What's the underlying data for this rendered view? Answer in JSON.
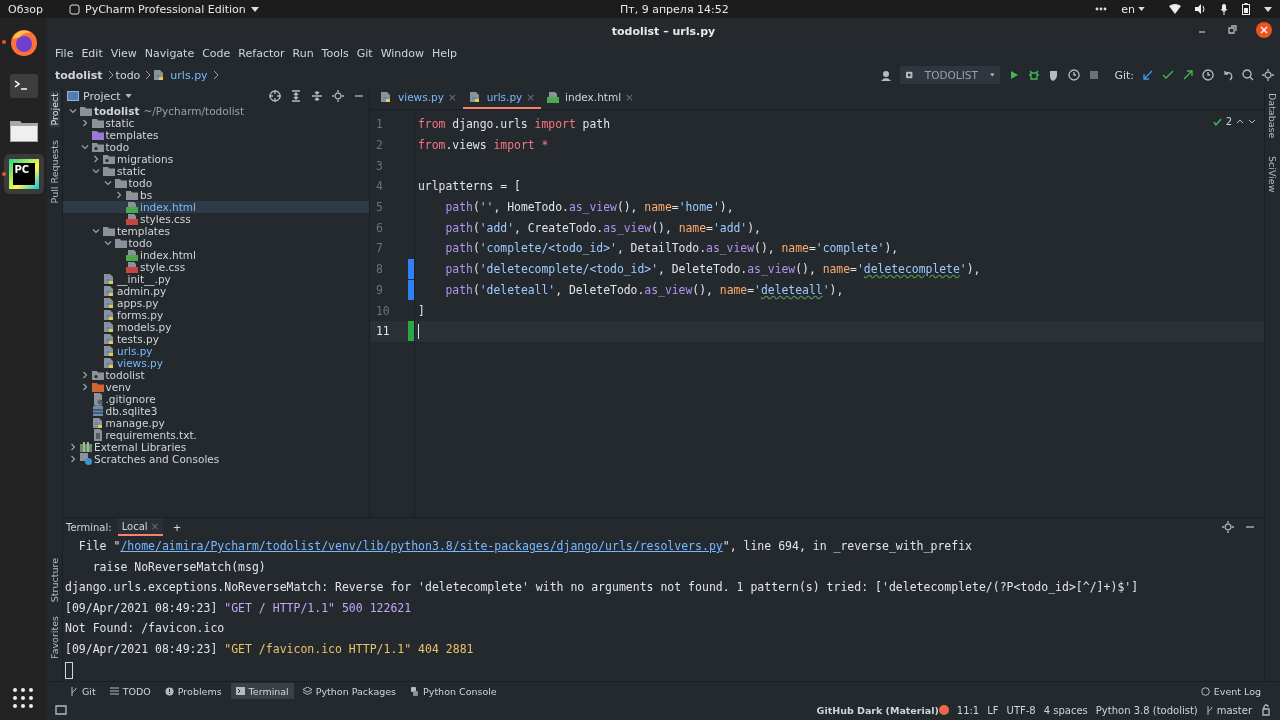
{
  "top_bar": {
    "activities": "Обзор",
    "app_menu": "PyCharm Professional Edition",
    "clock": "Пт, 9 апреля  14:52",
    "keyboard_layout": "en"
  },
  "dock": [
    {
      "kind": "firefox",
      "running": true,
      "selected": false
    },
    {
      "kind": "terminal",
      "running": false,
      "selected": false
    },
    {
      "kind": "files",
      "running": false,
      "selected": false
    },
    {
      "kind": "pycharm",
      "label": "PC",
      "running": true,
      "selected": true
    }
  ],
  "window": {
    "title": "todolist – urls.py"
  },
  "menu": [
    "File",
    "Edit",
    "View",
    "Navigate",
    "Code",
    "Refactor",
    "Run",
    "Tools",
    "Git",
    "Window",
    "Help"
  ],
  "breadcrumbs": [
    "todolist",
    "todo",
    "urls.py"
  ],
  "toolbar": {
    "run_config": "TODOLIST",
    "git_label": "Git:"
  },
  "left_stripe": {
    "top": [
      {
        "label": "Project",
        "selected": true
      },
      {
        "label": "Pull Requests",
        "selected": false
      }
    ],
    "bottom": [
      {
        "label": "Structure",
        "selected": false
      },
      {
        "label": "Favorites",
        "selected": false
      }
    ]
  },
  "project": {
    "title": "Project",
    "tree": [
      {
        "name": "todolist",
        "path": "~/Pycharm/todolist",
        "kind": "folder",
        "expanded": true,
        "selected": false,
        "modified": false,
        "children": [
          {
            "name": "static",
            "kind": "folder",
            "expanded": false,
            "selected": false,
            "modified": false
          },
          {
            "name": "templates",
            "kind": "template_folder",
            "selected": false,
            "modified": false
          },
          {
            "name": "todo",
            "kind": "package",
            "expanded": true,
            "selected": false,
            "modified": false,
            "children": [
              {
                "name": "migrations",
                "kind": "package",
                "expanded": false,
                "selected": false,
                "modified": false
              },
              {
                "name": "static",
                "kind": "folder",
                "expanded": true,
                "selected": false,
                "modified": false,
                "children": [
                  {
                    "name": "todo",
                    "kind": "folder",
                    "expanded": true,
                    "selected": false,
                    "modified": false,
                    "children": [
                      {
                        "name": "bs",
                        "kind": "folder",
                        "expanded": false,
                        "selected": false,
                        "modified": false
                      },
                      {
                        "name": "index.html",
                        "kind": "html",
                        "selected": true,
                        "modified": true
                      },
                      {
                        "name": "styles.css",
                        "kind": "css",
                        "selected": false,
                        "modified": false
                      }
                    ]
                  }
                ]
              },
              {
                "name": "templates",
                "kind": "folder",
                "expanded": true,
                "selected": false,
                "modified": false,
                "children": [
                  {
                    "name": "todo",
                    "kind": "folder",
                    "expanded": true,
                    "selected": false,
                    "modified": false,
                    "children": [
                      {
                        "name": "index.html",
                        "kind": "html",
                        "selected": false,
                        "modified": false
                      },
                      {
                        "name": "style.css",
                        "kind": "css",
                        "selected": false,
                        "modified": false
                      }
                    ]
                  }
                ]
              },
              {
                "name": "__init__.py",
                "kind": "py",
                "selected": false,
                "modified": false
              },
              {
                "name": "admin.py",
                "kind": "py",
                "selected": false,
                "modified": false
              },
              {
                "name": "apps.py",
                "kind": "py",
                "selected": false,
                "modified": false
              },
              {
                "name": "forms.py",
                "kind": "py",
                "selected": false,
                "modified": false
              },
              {
                "name": "models.py",
                "kind": "py",
                "selected": false,
                "modified": false
              },
              {
                "name": "tests.py",
                "kind": "py",
                "selected": false,
                "modified": false
              },
              {
                "name": "urls.py",
                "kind": "py",
                "selected": false,
                "modified": true
              },
              {
                "name": "views.py",
                "kind": "py",
                "selected": false,
                "modified": true
              }
            ]
          },
          {
            "name": "todolist",
            "kind": "package",
            "expanded": false,
            "selected": false,
            "modified": false
          },
          {
            "name": "venv",
            "kind": "excluded_folder",
            "expanded": false,
            "selected": false,
            "modified": false
          },
          {
            "name": ".gitignore",
            "kind": "gitignore",
            "selected": false,
            "modified": false
          },
          {
            "name": "db.sqlite3",
            "kind": "db",
            "selected": false,
            "modified": false
          },
          {
            "name": "manage.py",
            "kind": "py",
            "selected": false,
            "modified": false
          },
          {
            "name": "requirements.txt.",
            "kind": "txt",
            "selected": false,
            "modified": false
          }
        ]
      },
      {
        "name": "External Libraries",
        "kind": "libraries",
        "expanded": false,
        "selected": false,
        "modified": false
      },
      {
        "name": "Scratches and Consoles",
        "kind": "scratches",
        "expanded": false,
        "selected": false,
        "modified": false
      }
    ]
  },
  "editor": {
    "tabs": [
      {
        "label": "views.py",
        "kind": "py",
        "selected": false,
        "modified": true,
        "close": "×"
      },
      {
        "label": "urls.py",
        "kind": "py",
        "selected": true,
        "modified": true,
        "close": "×"
      },
      {
        "label": "index.html",
        "kind": "html",
        "selected": false,
        "modified": false,
        "close": "×"
      }
    ],
    "inspections": "2",
    "lines": [
      {
        "number": "1",
        "current": false,
        "modified": false,
        "added": false,
        "tokens": [
          {
            "text": "from",
            "kind": "kw"
          },
          {
            "text": " django.urls ",
            "kind": "plain"
          },
          {
            "text": "import",
            "kind": "kw"
          },
          {
            "text": " path",
            "kind": "plain"
          }
        ]
      },
      {
        "number": "2",
        "current": false,
        "modified": false,
        "added": false,
        "tokens": [
          {
            "text": "from",
            "kind": "kw"
          },
          {
            "text": ".views ",
            "kind": "plain"
          },
          {
            "text": "import",
            "kind": "kw"
          },
          {
            "text": " *",
            "kind": "kw"
          }
        ]
      },
      {
        "number": "3",
        "current": false,
        "modified": false,
        "added": false
      },
      {
        "number": "4",
        "current": false,
        "modified": false,
        "added": false,
        "tokens": [
          {
            "text": "urlpatterns = [",
            "kind": "plain"
          }
        ]
      },
      {
        "number": "5",
        "current": false,
        "modified": false,
        "added": false,
        "tokens": [
          {
            "text": "    path",
            "kind": "fn"
          },
          {
            "text": "(",
            "kind": "plain"
          },
          {
            "text": "''",
            "kind": "str"
          },
          {
            "text": ", HomeTodo.",
            "kind": "plain"
          },
          {
            "text": "as_view",
            "kind": "fn"
          },
          {
            "text": "(), ",
            "kind": "plain"
          },
          {
            "text": "name",
            "kind": "param"
          },
          {
            "text": "=",
            "kind": "plain"
          },
          {
            "text": "'home'",
            "kind": "str"
          },
          {
            "text": "),",
            "kind": "plain"
          }
        ]
      },
      {
        "number": "6",
        "current": false,
        "modified": false,
        "added": false,
        "tokens": [
          {
            "text": "    path",
            "kind": "fn"
          },
          {
            "text": "(",
            "kind": "plain"
          },
          {
            "text": "'add'",
            "kind": "str"
          },
          {
            "text": ", CreateTodo.",
            "kind": "plain"
          },
          {
            "text": "as_view",
            "kind": "fn"
          },
          {
            "text": "(), ",
            "kind": "plain"
          },
          {
            "text": "name",
            "kind": "param"
          },
          {
            "text": "=",
            "kind": "plain"
          },
          {
            "text": "'add'",
            "kind": "str"
          },
          {
            "text": "),",
            "kind": "plain"
          }
        ]
      },
      {
        "number": "7",
        "current": false,
        "modified": false,
        "added": false,
        "tokens": [
          {
            "text": "    path",
            "kind": "fn"
          },
          {
            "text": "(",
            "kind": "plain"
          },
          {
            "text": "'complete/<todo_id>'",
            "kind": "str"
          },
          {
            "text": ", DetailTodo.",
            "kind": "plain"
          },
          {
            "text": "as_view",
            "kind": "fn"
          },
          {
            "text": "(), ",
            "kind": "plain"
          },
          {
            "text": "name",
            "kind": "param"
          },
          {
            "text": "=",
            "kind": "plain"
          },
          {
            "text": "'complete'",
            "kind": "str"
          },
          {
            "text": "),",
            "kind": "plain"
          }
        ]
      },
      {
        "number": "8",
        "current": false,
        "modified": true,
        "added": false,
        "tokens": [
          {
            "text": "    path",
            "kind": "fn"
          },
          {
            "text": "(",
            "kind": "plain"
          },
          {
            "text": "'deletecomplete/<todo_id>'",
            "kind": "str"
          },
          {
            "text": ", DeleteTodo.",
            "kind": "plain"
          },
          {
            "text": "as_view",
            "kind": "fn"
          },
          {
            "text": "(), ",
            "kind": "plain"
          },
          {
            "text": "name",
            "kind": "param"
          },
          {
            "text": "=",
            "kind": "plain"
          },
          {
            "text": "'",
            "kind": "str"
          },
          {
            "text": "deletecomplete",
            "kind": "typo"
          },
          {
            "text": "'",
            "kind": "str"
          },
          {
            "text": "),",
            "kind": "plain"
          }
        ]
      },
      {
        "number": "9",
        "current": false,
        "modified": true,
        "added": false,
        "tokens": [
          {
            "text": "    path",
            "kind": "fn"
          },
          {
            "text": "(",
            "kind": "plain"
          },
          {
            "text": "'deleteall'",
            "kind": "str"
          },
          {
            "text": ", DeleteTodo.",
            "kind": "plain"
          },
          {
            "text": "as_view",
            "kind": "fn"
          },
          {
            "text": "(), ",
            "kind": "plain"
          },
          {
            "text": "name",
            "kind": "param"
          },
          {
            "text": "=",
            "kind": "plain"
          },
          {
            "text": "'",
            "kind": "str"
          },
          {
            "text": "deleteall",
            "kind": "typo"
          },
          {
            "text": "'",
            "kind": "str"
          },
          {
            "text": "),",
            "kind": "plain"
          }
        ]
      },
      {
        "number": "10",
        "current": false,
        "modified": false,
        "added": false,
        "tokens": [
          {
            "text": "]",
            "kind": "plain"
          }
        ]
      },
      {
        "number": "11",
        "current": true,
        "modified": false,
        "added": true
      }
    ]
  },
  "right_stripe": [
    "Database",
    "SciView"
  ],
  "terminal": {
    "label": "Terminal:",
    "tabs": [
      {
        "label": "Local",
        "close": "×",
        "selected": true
      }
    ],
    "add": "+",
    "lines": [
      {
        "tokens": [
          {
            "text": "  File \"",
            "kind": "plain"
          },
          {
            "text": "/home/aimira/Pycharm/todolist/venv/lib/python3.8/site-packages/django/urls/resolvers.py",
            "kind": "link"
          },
          {
            "text": "\", line 694, in _reverse_with_prefix",
            "kind": "plain"
          }
        ]
      },
      {
        "tokens": [
          {
            "text": "    raise NoReverseMatch(msg)",
            "kind": "plain"
          }
        ]
      },
      {
        "tokens": [
          {
            "text": "django.urls.exceptions.NoReverseMatch: Reverse for 'deletecomplete' with no arguments not found. 1 pattern(s) tried: ['deletecomplete/(?P<todo_id>[^/]+)$']",
            "kind": "plain"
          }
        ]
      },
      {
        "tokens": [
          {
            "text": "[09/Apr/2021 08:49:23] ",
            "kind": "plain"
          },
          {
            "text": "\"GET / HTTP/1.1\" 500 122621",
            "kind": "error"
          }
        ]
      },
      {
        "tokens": [
          {
            "text": "Not Found: /favicon.ico",
            "kind": "plain"
          }
        ]
      },
      {
        "tokens": [
          {
            "text": "[09/Apr/2021 08:49:23] ",
            "kind": "plain"
          },
          {
            "text": "\"GET /favicon.ico HTTP/1.1\" 404 2881",
            "kind": "warn"
          }
        ]
      }
    ]
  },
  "tool_windows": [
    {
      "label": "Git",
      "kind": "git",
      "selected": false
    },
    {
      "label": "TODO",
      "kind": "todo",
      "selected": false
    },
    {
      "label": "Problems",
      "kind": "problems",
      "selected": false
    },
    {
      "label": "Terminal",
      "kind": "terminal",
      "selected": true
    },
    {
      "label": "Python Packages",
      "kind": "packages",
      "selected": false
    },
    {
      "label": "Python Console",
      "kind": "console",
      "selected": false
    }
  ],
  "event_log": "Event Log",
  "status_bar": {
    "theme": "GitHub Dark (Material)",
    "position": "11:1",
    "line_separator": "LF",
    "encoding": "UTF-8",
    "indent": "4 spaces",
    "interpreter": "Python 3.8 (todolist)",
    "branch": "master"
  }
}
